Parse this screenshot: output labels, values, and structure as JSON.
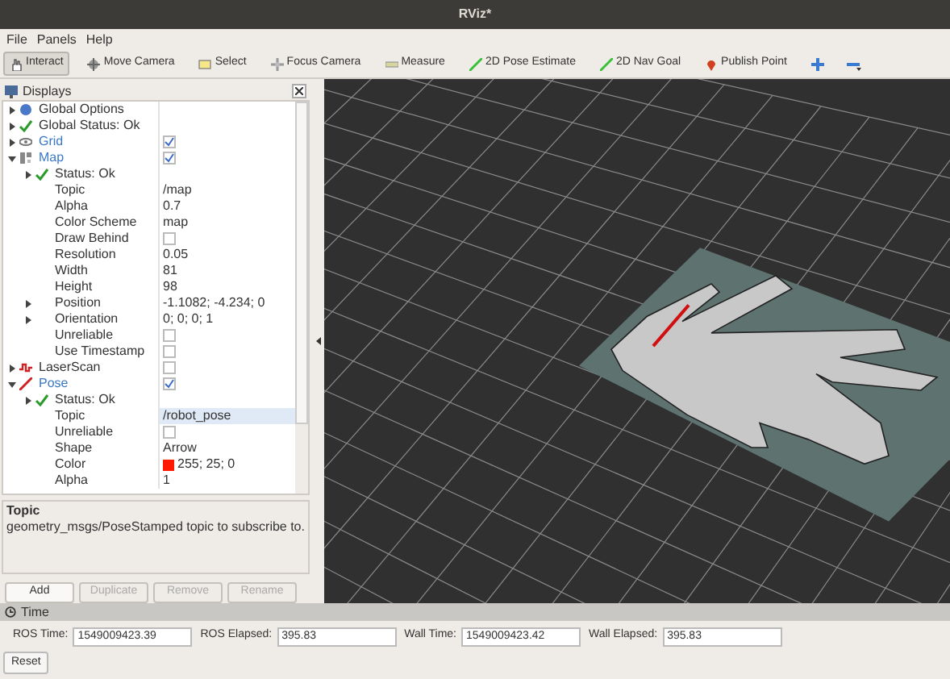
{
  "window": {
    "title": "RViz*"
  },
  "menu": [
    "File",
    "Panels",
    "Help"
  ],
  "toolbar": [
    {
      "label": "Interact",
      "kind": "hand",
      "selected": true
    },
    {
      "label": "Move Camera",
      "kind": "move",
      "selected": false
    },
    {
      "label": "Select",
      "kind": "select",
      "selected": false
    },
    {
      "label": "Focus Camera",
      "kind": "focus",
      "selected": false
    },
    {
      "label": "Measure",
      "kind": "ruler",
      "selected": false
    },
    {
      "label": "2D Pose Estimate",
      "kind": "arrow",
      "selected": false
    },
    {
      "label": "2D Nav Goal",
      "kind": "arrow",
      "selected": false
    },
    {
      "label": "Publish Point",
      "kind": "pin",
      "selected": false
    }
  ],
  "displays": {
    "title": "Displays",
    "tree": [
      {
        "label": "Global Options",
        "kind": "options",
        "expanded": false
      },
      {
        "label": "Global Status: Ok",
        "kind": "status",
        "expanded": false
      },
      {
        "label": "Grid",
        "kind": "grid",
        "expanded": false,
        "checked": true
      },
      {
        "label": "Map",
        "kind": "map",
        "expanded": true,
        "checked": true,
        "children": [
          {
            "label": "Status: Ok",
            "kind": "status",
            "expanded": false
          },
          {
            "label": "Topic",
            "kind": "text",
            "value": "/map"
          },
          {
            "label": "Alpha",
            "kind": "text",
            "value": "0.7"
          },
          {
            "label": "Color Scheme",
            "kind": "text",
            "value": "map"
          },
          {
            "label": "Draw Behind",
            "kind": "checkbox",
            "checked": false
          },
          {
            "label": "Resolution",
            "kind": "text",
            "value": "0.05"
          },
          {
            "label": "Width",
            "kind": "text",
            "value": "81"
          },
          {
            "label": "Height",
            "kind": "text",
            "value": "98"
          },
          {
            "label": "Position",
            "kind": "text",
            "value": "-1.1082; -4.234; 0",
            "expanded": false
          },
          {
            "label": "Orientation",
            "kind": "text",
            "value": "0; 0; 0; 1",
            "expanded": false
          },
          {
            "label": "Unreliable",
            "kind": "checkbox",
            "checked": false
          },
          {
            "label": "Use Timestamp",
            "kind": "checkbox",
            "checked": false
          }
        ]
      },
      {
        "label": "LaserScan",
        "kind": "laser",
        "expanded": false,
        "checked": false
      },
      {
        "label": "Pose",
        "kind": "pose",
        "expanded": true,
        "checked": true,
        "children": [
          {
            "label": "Status: Ok",
            "kind": "status",
            "expanded": false
          },
          {
            "label": "Topic",
            "kind": "text",
            "value": "/robot_pose",
            "selected": true
          },
          {
            "label": "Unreliable",
            "kind": "checkbox",
            "checked": false
          },
          {
            "label": "Shape",
            "kind": "text",
            "value": "Arrow"
          },
          {
            "label": "Color",
            "kind": "color",
            "value": "255; 25; 0",
            "color": "#ff1900"
          },
          {
            "label": "Alpha",
            "kind": "text",
            "value": "1"
          }
        ]
      }
    ],
    "description": {
      "title": "Topic",
      "text": "geometry_msgs/PoseStamped topic to subscribe to."
    },
    "buttons": [
      {
        "label": "Add",
        "disabled": false
      },
      {
        "label": "Duplicate",
        "disabled": true
      },
      {
        "label": "Remove",
        "disabled": true
      },
      {
        "label": "Rename",
        "disabled": true
      }
    ]
  },
  "time": {
    "title": "Time",
    "fields": [
      {
        "label": "ROS Time:",
        "value": "1549009423.39"
      },
      {
        "label": "ROS Elapsed:",
        "value": "395.83"
      },
      {
        "label": "Wall Time:",
        "value": "1549009423.42"
      },
      {
        "label": "Wall Elapsed:",
        "value": "395.83"
      }
    ],
    "reset": "Reset"
  }
}
